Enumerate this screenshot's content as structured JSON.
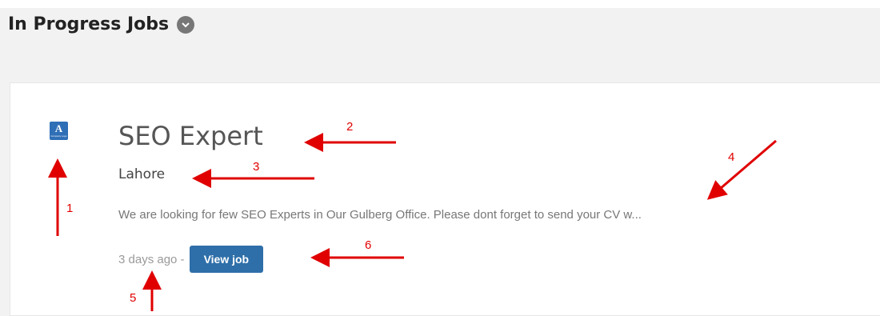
{
  "header": {
    "title": "In Progress Jobs",
    "toggle_icon": "chevron-down-icon"
  },
  "job": {
    "logo_letter": "A",
    "logo_caption": "Company Logo",
    "title": "SEO Expert",
    "location": "Lahore",
    "description": "We are looking for few SEO Experts in Our Gulberg Office. Please dont forget to send your CV w...",
    "posted": "3 days ago -",
    "view_label": "View job"
  },
  "annotations": {
    "labels": [
      "1",
      "2",
      "3",
      "4",
      "5",
      "6"
    ],
    "color": "#e00000"
  },
  "colors": {
    "accent": "#2e6fa9",
    "logo_bg": "#2f6fb6",
    "page_bg": "#f2f2f2"
  }
}
